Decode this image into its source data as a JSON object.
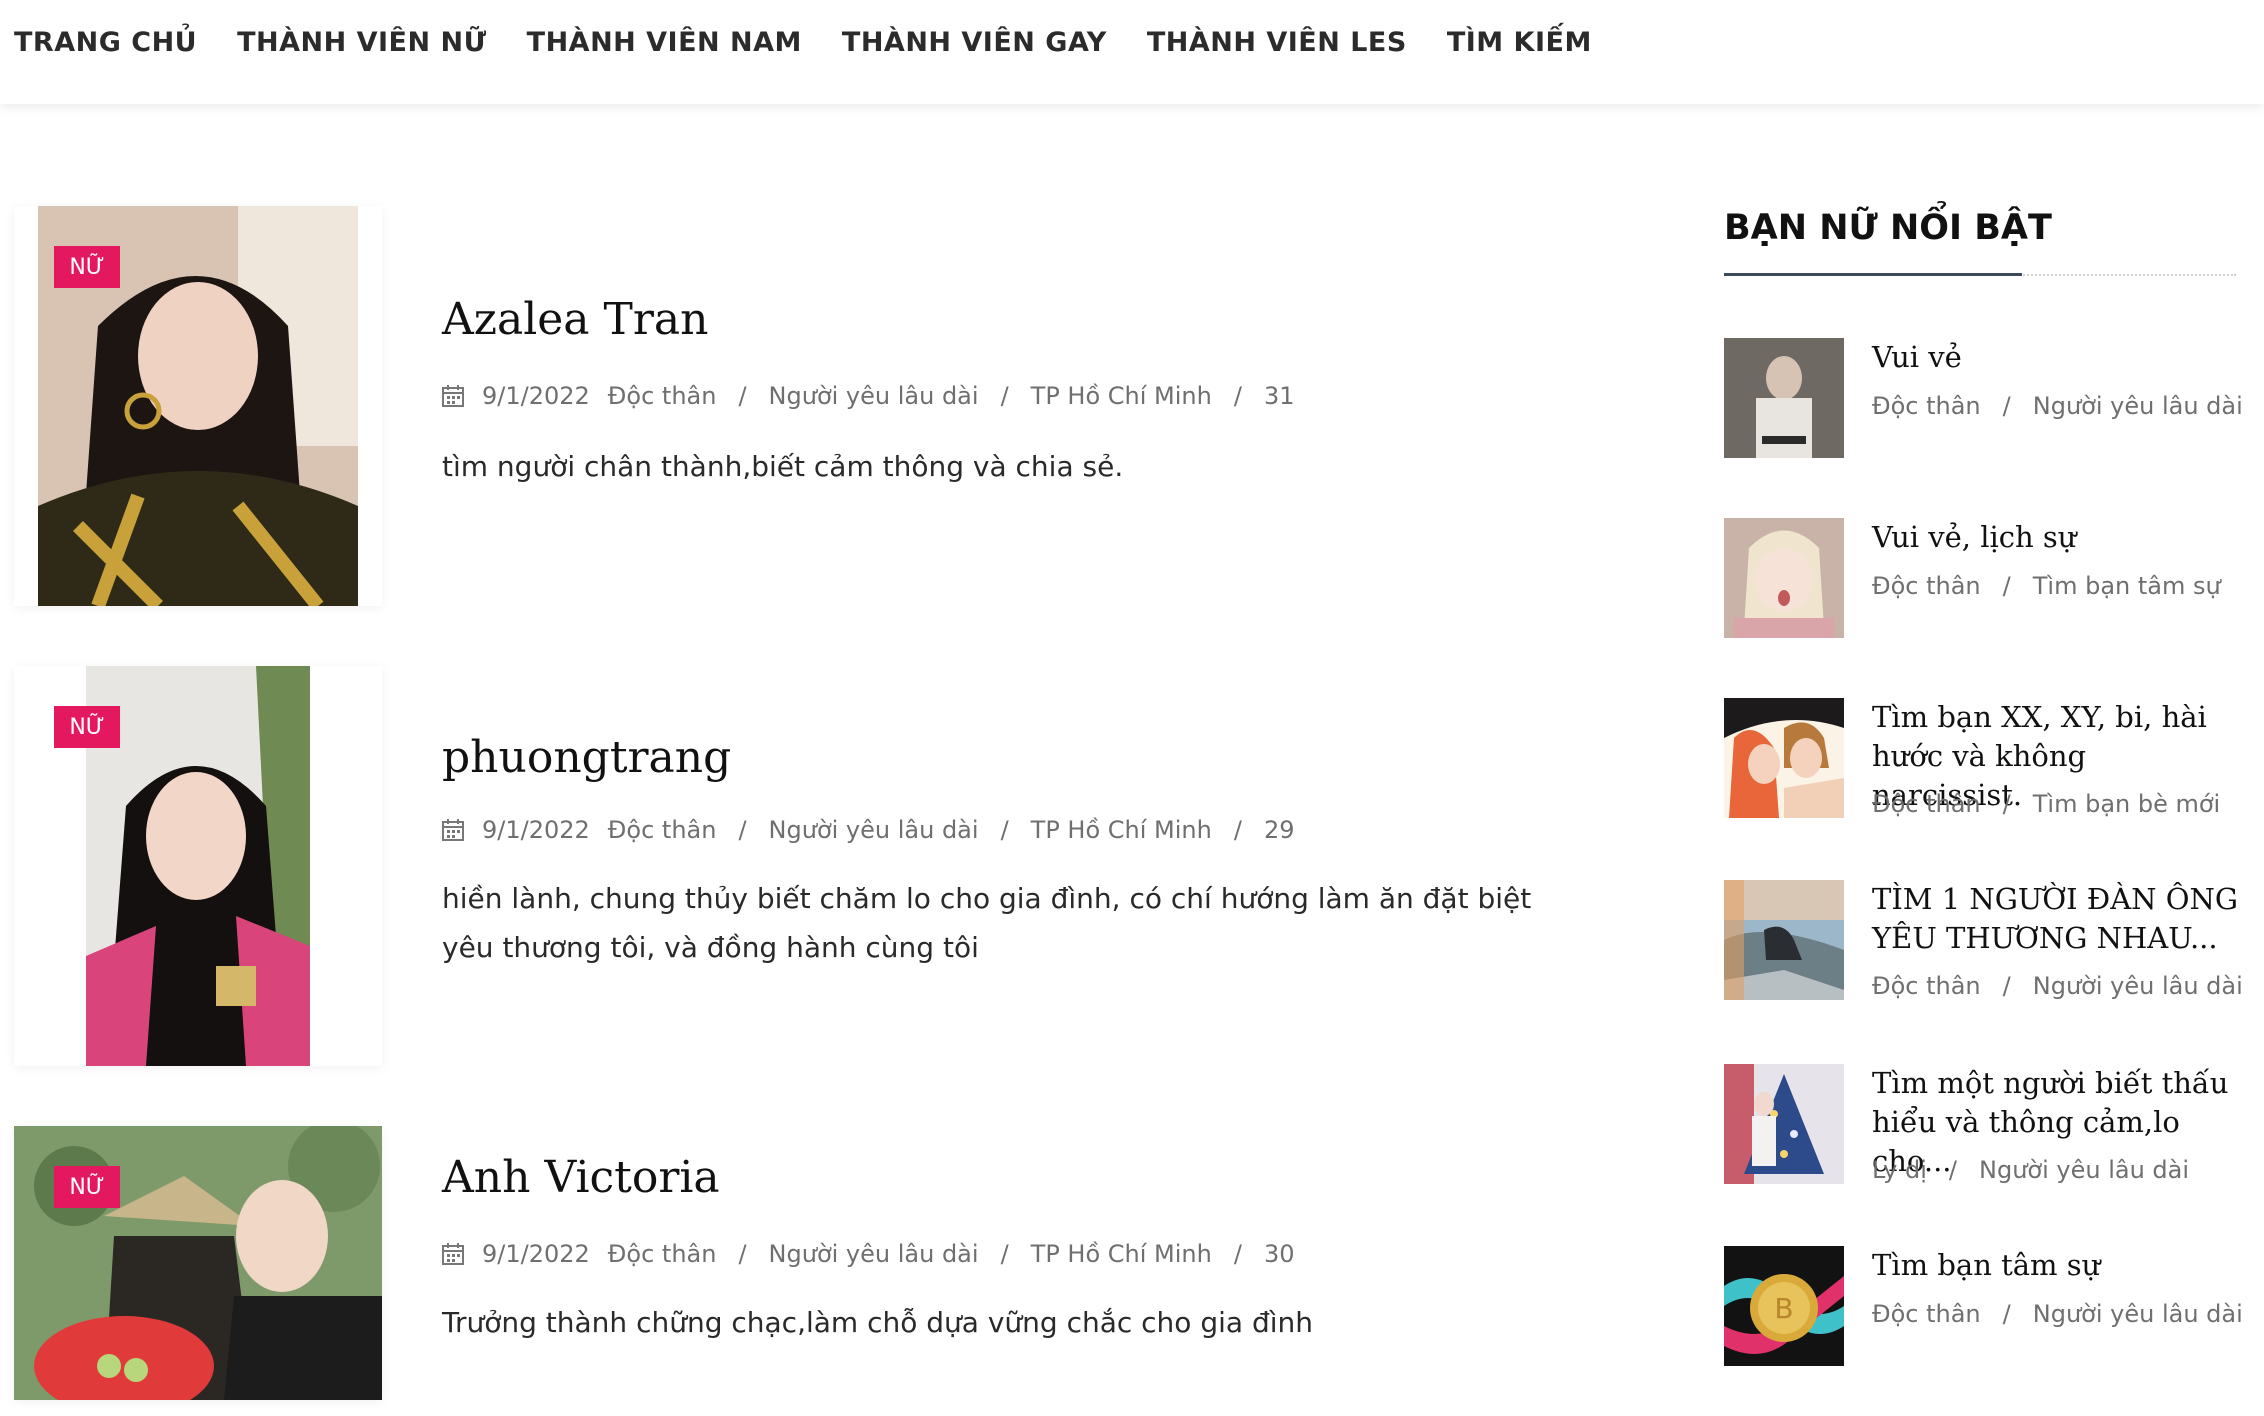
{
  "nav": {
    "items": [
      "TRANG CHỦ",
      "THÀNH VIÊN NỮ",
      "THÀNH VIÊN NAM",
      "THÀNH VIÊN GAY",
      "THÀNH VIÊN LES",
      "TÌM KIẾM"
    ]
  },
  "posts": [
    {
      "tag": "NỮ",
      "name": "Azalea Tran",
      "date": "9/1/2022",
      "status": "Độc thân",
      "goal": "Người yêu lâu dài",
      "location": "TP Hồ Chí Minh",
      "age": "31",
      "excerpt": "tìm người chân thành,biết cảm thông và chia sẻ."
    },
    {
      "tag": "NỮ",
      "name": "phuongtrang",
      "date": "9/1/2022",
      "status": "Độc thân",
      "goal": "Người yêu lâu dài",
      "location": "TP Hồ Chí Minh",
      "age": "29",
      "excerpt": "hiền lành, chung thủy biết chăm lo cho gia đình, có chí hướng làm ăn đặt biệt yêu thương tôi, và đồng hành cùng tôi"
    },
    {
      "tag": "NỮ",
      "name": "Anh Victoria",
      "date": "9/1/2022",
      "status": "Độc thân",
      "goal": "Người yêu lâu dài",
      "location": "TP Hồ Chí Minh",
      "age": "30",
      "excerpt": "Trưởng thành chững chạc,làm chỗ dựa vững chắc cho gia đình"
    }
  ],
  "sidebar": {
    "title": "BẠN NỮ NỔI BẬT",
    "items": [
      {
        "name": "Vui vẻ",
        "status": "Độc thân",
        "goal": "Người yêu lâu dài"
      },
      {
        "name": "Vui vẻ, lịch sự",
        "status": "Độc thân",
        "goal": "Tìm bạn tâm sự"
      },
      {
        "name": "Tìm bạn XX, XY, bi, hài hước và không narcissist.",
        "status": "Độc thân",
        "goal": "Tìm bạn bè mới"
      },
      {
        "name": "TÌM 1 NGƯỜI ĐÀN ÔNG YÊU THƯƠNG NHAU...",
        "status": "Độc thân",
        "goal": "Người yêu lâu dài"
      },
      {
        "name": "Tìm một người biết thấu hiểu và thông cảm,lo cho...",
        "status": "Ly dị",
        "goal": "Người yêu lâu dài"
      },
      {
        "name": "Tìm bạn tâm sự",
        "status": "Độc thân",
        "goal": "Người yêu lâu dài"
      }
    ]
  },
  "colors": {
    "tag": "#e4185f",
    "accent": "#3a4a5c",
    "meta": "#6f6f6f"
  },
  "icons": {
    "meta_date": "calendar-icon"
  }
}
